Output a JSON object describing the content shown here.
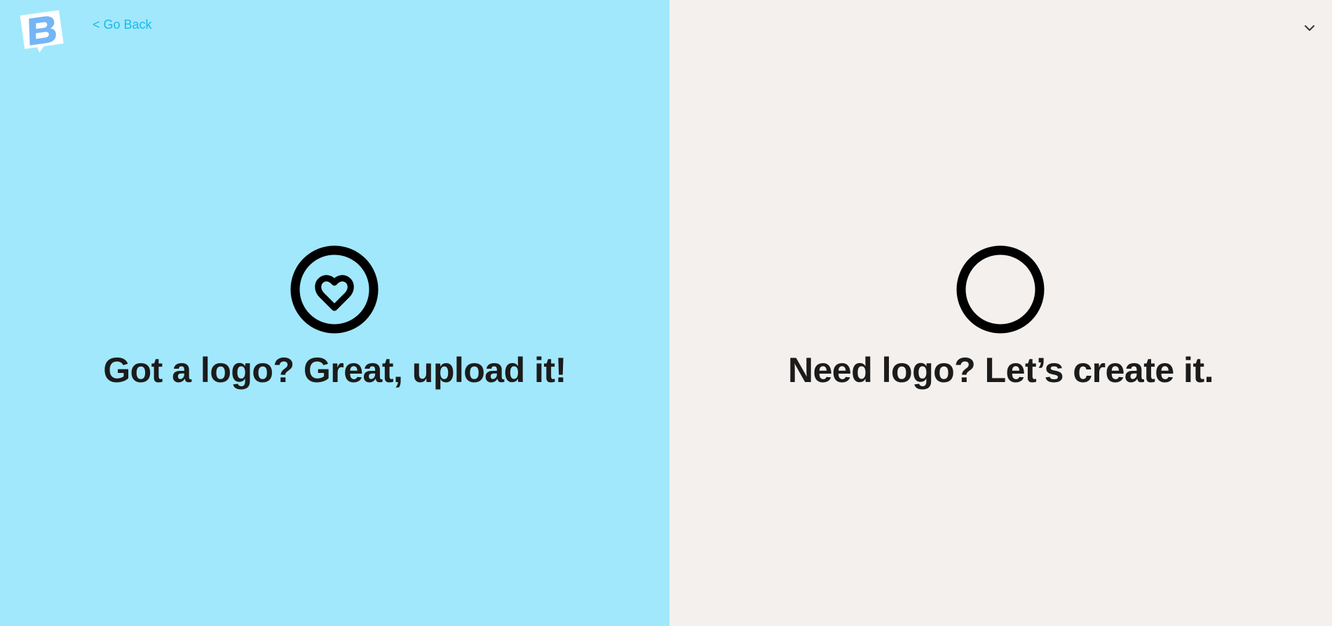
{
  "header": {
    "logo_icon": "brand-b-speech-bubble-logo",
    "back_label": "< Go Back",
    "dropdown_icon": "chevron-down-icon"
  },
  "options": [
    {
      "title": "Got a logo? Great, upload it!",
      "icon": "heart-circle-icon",
      "background": "#a1e8fc"
    },
    {
      "title": "Need logo? Let’s create it.",
      "icon": "empty-circle-icon",
      "background": "#f3f0ee"
    }
  ],
  "colors": {
    "link": "#19b9ec",
    "heading": "#1b1b1b",
    "logo_blue": "#74b6f5"
  }
}
